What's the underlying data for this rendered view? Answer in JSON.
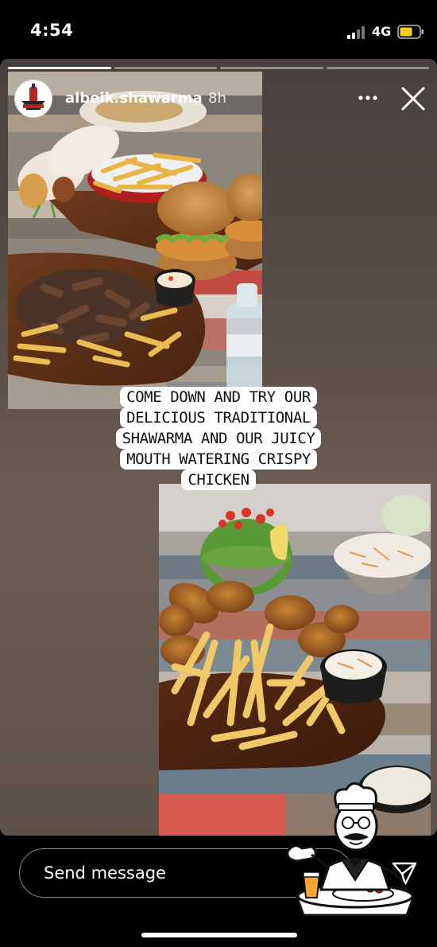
{
  "status_bar": {
    "time": "4:54",
    "network": "4G",
    "signal_icon": "cell-signal-icon",
    "battery_icon": "battery-icon",
    "battery_color": "#f5cf1c"
  },
  "story": {
    "segments": 4,
    "current_segment": 1,
    "username": "albeik.shawarma",
    "posted_ago": "8h",
    "caption_lines": [
      "COME DOWN AND TRY OUR",
      "DELICIOUS TRADITIONAL",
      "SHAWARMA AND OUR JUICY",
      "MOUTH WATERING CRISPY",
      "CHICKEN"
    ],
    "icons": {
      "more": "more-options-icon",
      "close": "close-icon",
      "avatar": "avatar"
    }
  },
  "bottom_bar": {
    "message_placeholder": "Send message",
    "share_icon": "share-icon"
  }
}
